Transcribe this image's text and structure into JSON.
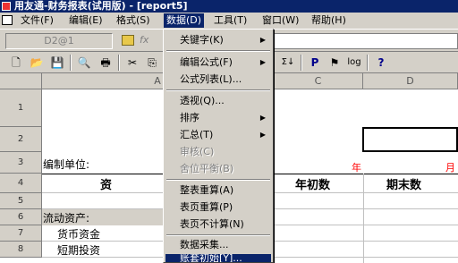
{
  "window": {
    "title": "用友通-财务报表(试用版) - [report5]"
  },
  "menubar": {
    "items": [
      {
        "label": "文件(F)"
      },
      {
        "label": "编辑(E)"
      },
      {
        "label": "格式(S)"
      },
      {
        "label": "数据(D)"
      },
      {
        "label": "工具(T)"
      },
      {
        "label": "窗口(W)"
      },
      {
        "label": "帮助(H)"
      }
    ]
  },
  "formula": {
    "cell_ref": "D2@1",
    "fx_label": "fx"
  },
  "toolbar": {
    "sigma_label": "Σ↓",
    "p_label": "P",
    "log_label": "log",
    "help_label": "?"
  },
  "sheet": {
    "columns": [
      "A",
      "C",
      "D"
    ],
    "rows": [
      "1",
      "2",
      "3",
      "4",
      "5",
      "6",
      "7",
      "8"
    ],
    "cells": {
      "unit_label": "编制单位:",
      "year_label": "年",
      "month_label": "月",
      "assets_header": "资 产",
      "begin_header": "年初数",
      "end_header": "期末数",
      "current_assets": "流动资产:",
      "cash": "货币资金",
      "short_invest": "短期投资"
    }
  },
  "data_menu": {
    "items": [
      {
        "label": "关键字(K)",
        "submenu": true
      },
      {
        "label": "编辑公式(F)",
        "submenu": true
      },
      {
        "label": "公式列表(L)..."
      },
      {
        "label": "透视(Q)..."
      },
      {
        "label": "排序",
        "submenu": true
      },
      {
        "label": "汇总(T)",
        "submenu": true
      },
      {
        "label": "审核(C)",
        "disabled": true
      },
      {
        "label": "舍位平衡(B)",
        "disabled": true
      },
      {
        "label": "整表重算(A)"
      },
      {
        "label": "表页重算(P)"
      },
      {
        "label": "表页不计算(N)"
      },
      {
        "label": "数据采集..."
      },
      {
        "label": "账套初始[Y]...",
        "highlighted": true
      }
    ]
  },
  "colors": {
    "title_bg": "#0a246a",
    "menu_highlight": "#0a246a",
    "red_text": "#ff0000"
  }
}
